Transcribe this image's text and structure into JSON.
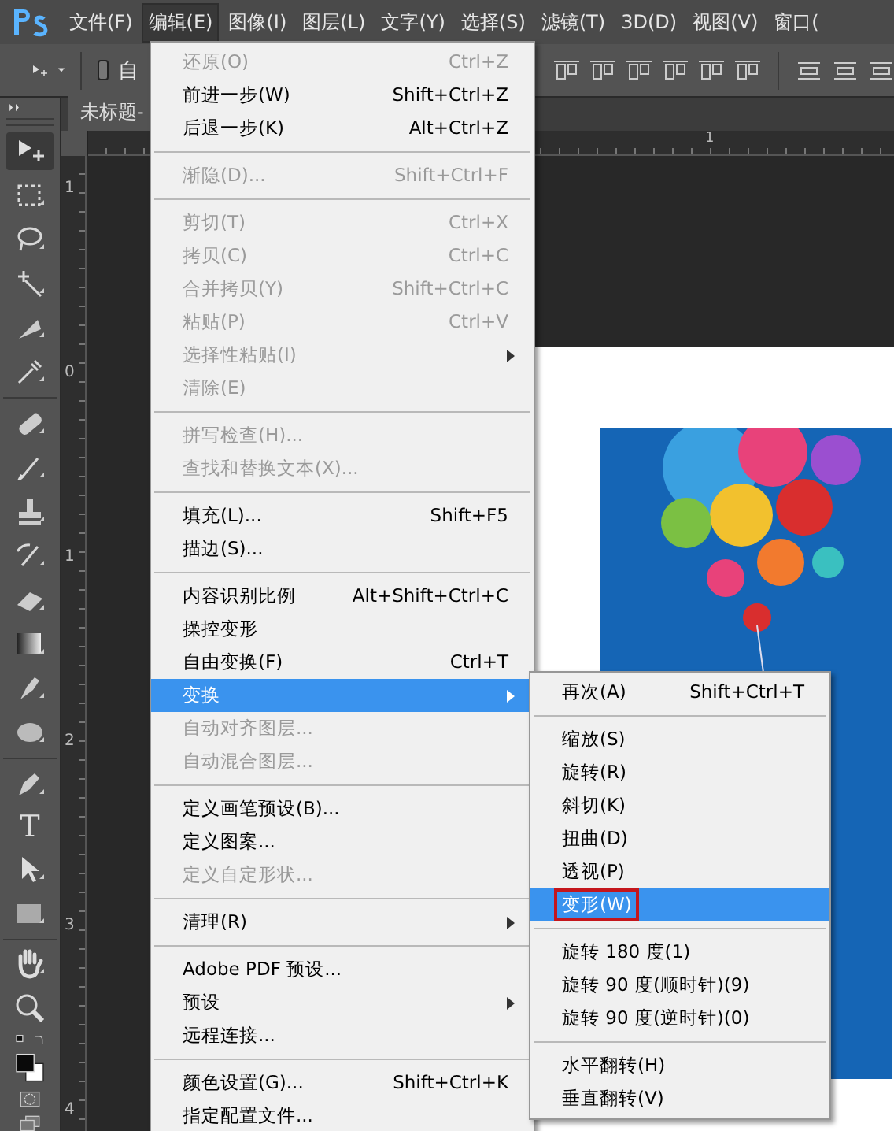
{
  "menubar": [
    {
      "label": "文件(F)",
      "selected": false
    },
    {
      "label": "编辑(E)",
      "selected": true
    },
    {
      "label": "图像(I)",
      "selected": false
    },
    {
      "label": "图层(L)",
      "selected": false
    },
    {
      "label": "文字(Y)",
      "selected": false
    },
    {
      "label": "选择(S)",
      "selected": false
    },
    {
      "label": "滤镜(T)",
      "selected": false
    },
    {
      "label": "3D(D)",
      "selected": false
    },
    {
      "label": "视图(V)",
      "selected": false
    },
    {
      "label": "窗口(",
      "selected": false
    }
  ],
  "options_bar": {
    "checkbox_label": "自",
    "checked": false
  },
  "document_tab": {
    "label": "未标题-"
  },
  "toolbar": {
    "type_tool": "T"
  },
  "top_ruler": [
    "1"
  ],
  "vertical_ruler": [
    "1",
    "0",
    "1",
    "2",
    "3",
    "4"
  ],
  "edit_menu": [
    {
      "kind": "item",
      "label": "还原(O)",
      "shortcut": "Ctrl+Z",
      "disabled": true,
      "submenu": false,
      "selected": false
    },
    {
      "kind": "item",
      "label": "前进一步(W)",
      "shortcut": "Shift+Ctrl+Z",
      "disabled": false,
      "submenu": false,
      "selected": false
    },
    {
      "kind": "item",
      "label": "后退一步(K)",
      "shortcut": "Alt+Ctrl+Z",
      "disabled": false,
      "submenu": false,
      "selected": false
    },
    {
      "kind": "separator"
    },
    {
      "kind": "item",
      "label": "渐隐(D)...",
      "shortcut": "Shift+Ctrl+F",
      "disabled": true,
      "submenu": false,
      "selected": false
    },
    {
      "kind": "separator"
    },
    {
      "kind": "item",
      "label": "剪切(T)",
      "shortcut": "Ctrl+X",
      "disabled": true,
      "submenu": false,
      "selected": false
    },
    {
      "kind": "item",
      "label": "拷贝(C)",
      "shortcut": "Ctrl+C",
      "disabled": true,
      "submenu": false,
      "selected": false
    },
    {
      "kind": "item",
      "label": "合并拷贝(Y)",
      "shortcut": "Shift+Ctrl+C",
      "disabled": true,
      "submenu": false,
      "selected": false
    },
    {
      "kind": "item",
      "label": "粘贴(P)",
      "shortcut": "Ctrl+V",
      "disabled": true,
      "submenu": false,
      "selected": false
    },
    {
      "kind": "item",
      "label": "选择性粘贴(I)",
      "disabled": true,
      "submenu": true,
      "selected": false
    },
    {
      "kind": "item",
      "label": "清除(E)",
      "disabled": true,
      "submenu": false,
      "selected": false
    },
    {
      "kind": "separator"
    },
    {
      "kind": "item",
      "label": "拼写检查(H)...",
      "disabled": true,
      "submenu": false,
      "selected": false
    },
    {
      "kind": "item",
      "label": "查找和替换文本(X)...",
      "disabled": true,
      "submenu": false,
      "selected": false
    },
    {
      "kind": "separator"
    },
    {
      "kind": "item",
      "label": "填充(L)...",
      "shortcut": "Shift+F5",
      "disabled": false,
      "submenu": false,
      "selected": false
    },
    {
      "kind": "item",
      "label": "描边(S)...",
      "disabled": false,
      "submenu": false,
      "selected": false
    },
    {
      "kind": "separator"
    },
    {
      "kind": "item",
      "label": "内容识别比例",
      "shortcut": "Alt+Shift+Ctrl+C",
      "disabled": false,
      "submenu": false,
      "selected": false
    },
    {
      "kind": "item",
      "label": "操控变形",
      "disabled": false,
      "submenu": false,
      "selected": false
    },
    {
      "kind": "item",
      "label": "自由变换(F)",
      "shortcut": "Ctrl+T",
      "disabled": false,
      "submenu": false,
      "selected": false
    },
    {
      "kind": "item",
      "label": "变换",
      "disabled": false,
      "submenu": true,
      "selected": true
    },
    {
      "kind": "item",
      "label": "自动对齐图层...",
      "disabled": true,
      "submenu": false,
      "selected": false
    },
    {
      "kind": "item",
      "label": "自动混合图层...",
      "disabled": true,
      "submenu": false,
      "selected": false
    },
    {
      "kind": "separator"
    },
    {
      "kind": "item",
      "label": "定义画笔预设(B)...",
      "disabled": false,
      "submenu": false,
      "selected": false
    },
    {
      "kind": "item",
      "label": "定义图案...",
      "disabled": false,
      "submenu": false,
      "selected": false
    },
    {
      "kind": "item",
      "label": "定义自定形状...",
      "disabled": true,
      "submenu": false,
      "selected": false
    },
    {
      "kind": "separator"
    },
    {
      "kind": "item",
      "label": "清理(R)",
      "disabled": false,
      "submenu": true,
      "selected": false
    },
    {
      "kind": "separator"
    },
    {
      "kind": "item",
      "label": "Adobe PDF 预设...",
      "disabled": false,
      "submenu": false,
      "selected": false
    },
    {
      "kind": "item",
      "label": "预设",
      "disabled": false,
      "submenu": true,
      "selected": false
    },
    {
      "kind": "item",
      "label": "远程连接...",
      "disabled": false,
      "submenu": false,
      "selected": false
    },
    {
      "kind": "separator"
    },
    {
      "kind": "item",
      "label": "颜色设置(G)...",
      "shortcut": "Shift+Ctrl+K",
      "disabled": false,
      "submenu": false,
      "selected": false
    },
    {
      "kind": "item",
      "label": "指定配置文件...",
      "disabled": false,
      "submenu": false,
      "selected": false
    }
  ],
  "transform_submenu": [
    {
      "kind": "item",
      "label": "再次(A)",
      "shortcut": "Shift+Ctrl+T",
      "selected": false,
      "annotated": false
    },
    {
      "kind": "separator"
    },
    {
      "kind": "item",
      "label": "缩放(S)",
      "selected": false,
      "annotated": false
    },
    {
      "kind": "item",
      "label": "旋转(R)",
      "selected": false,
      "annotated": false
    },
    {
      "kind": "item",
      "label": "斜切(K)",
      "selected": false,
      "annotated": false
    },
    {
      "kind": "item",
      "label": "扭曲(D)",
      "selected": false,
      "annotated": false
    },
    {
      "kind": "item",
      "label": "透视(P)",
      "selected": false,
      "annotated": false
    },
    {
      "kind": "item",
      "label": "变形(W)",
      "selected": true,
      "annotated": true
    },
    {
      "kind": "separator"
    },
    {
      "kind": "item",
      "label": "旋转 180 度(1)",
      "selected": false,
      "annotated": false
    },
    {
      "kind": "item",
      "label": "旋转 90 度(顺时针)(9)",
      "selected": false,
      "annotated": false
    },
    {
      "kind": "item",
      "label": "旋转 90 度(逆时针)(0)",
      "selected": false,
      "annotated": false
    },
    {
      "kind": "separator"
    },
    {
      "kind": "item",
      "label": "水平翻转(H)",
      "selected": false,
      "annotated": false
    },
    {
      "kind": "item",
      "label": "垂直翻转(V)",
      "selected": false,
      "annotated": false
    }
  ]
}
